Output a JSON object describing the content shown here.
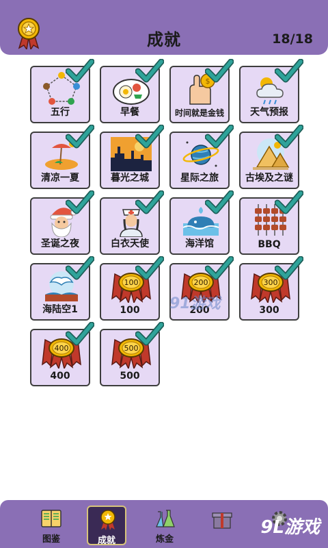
{
  "header": {
    "title": "成就",
    "counter": "18/18",
    "badge_icon": "award-ribbon-icon"
  },
  "achievements": [
    {
      "label": "五行",
      "icon": "five-elements-diagram-icon",
      "done": true
    },
    {
      "label": "早餐",
      "icon": "breakfast-plate-icon",
      "done": true
    },
    {
      "label": "时间就是金钱",
      "icon": "hand-coin-icon",
      "done": true
    },
    {
      "label": "天气预报",
      "icon": "weather-cloud-sun-icon",
      "done": true
    },
    {
      "label": "清凉一夏",
      "icon": "summer-beach-icon",
      "done": true
    },
    {
      "label": "暮光之城",
      "icon": "twilight-castle-icon",
      "done": true
    },
    {
      "label": "星际之旅",
      "icon": "planet-icon",
      "done": true
    },
    {
      "label": "古埃及之谜",
      "icon": "pyramid-icon",
      "done": true
    },
    {
      "label": "圣诞之夜",
      "icon": "santa-icon",
      "done": true
    },
    {
      "label": "白衣天使",
      "icon": "nurse-icon",
      "done": true
    },
    {
      "label": "海洋馆",
      "icon": "whale-icon",
      "done": true
    },
    {
      "label": "BBQ",
      "icon": "bbq-skewers-icon",
      "done": true
    },
    {
      "label": "海陆空1",
      "icon": "sea-land-air-icon",
      "done": true
    },
    {
      "label": "100",
      "icon": "medal-ribbon-icon",
      "medal_text": "100",
      "done": true
    },
    {
      "label": "200",
      "icon": "medal-ribbon-icon",
      "medal_text": "200",
      "done": true
    },
    {
      "label": "300",
      "icon": "medal-ribbon-icon",
      "medal_text": "300",
      "done": true
    },
    {
      "label": "400",
      "icon": "medal-ribbon-icon",
      "medal_text": "400",
      "done": true
    },
    {
      "label": "500",
      "icon": "medal-ribbon-icon",
      "medal_text": "500",
      "done": true
    }
  ],
  "nav": [
    {
      "label": "图鉴",
      "icon": "book-icon",
      "active": false
    },
    {
      "label": "成就",
      "icon": "award-ribbon-icon",
      "active": true
    },
    {
      "label": "炼金",
      "icon": "flask-icon",
      "active": false
    },
    {
      "label": "",
      "icon": "gift-icon",
      "active": false
    },
    {
      "label": "",
      "icon": "gear-icon",
      "active": false
    }
  ],
  "watermark": {
    "center": "91游戏",
    "corner": "9L游戏"
  },
  "colors": {
    "header_bg": "#8a6fb5",
    "tile_bg": "#e6d9f5",
    "check": "#2fa39a",
    "medal_ribbon": "#c0392b",
    "medal_coin": "#f2b705"
  }
}
